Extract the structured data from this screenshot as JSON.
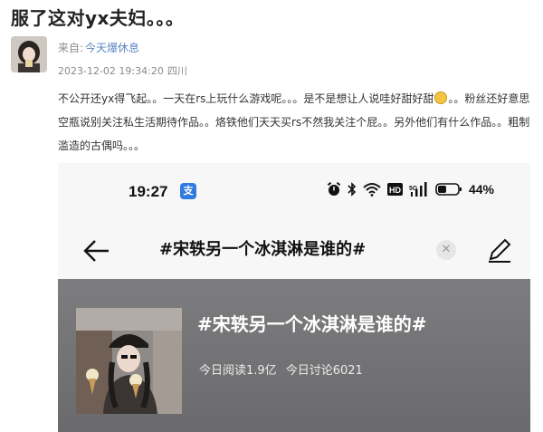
{
  "post": {
    "title": "服了这对yx夫妇。。。",
    "from_label": "来自:",
    "from_source": "今天爆休息",
    "timestamp": "2023-12-02 19:34:20",
    "location": "四川",
    "body_part1": "不公开还yx得飞起。。一天在rs上玩什么游戏呢。。。是不是想让人说哇好甜好甜",
    "body_part2": "。。粉丝还好意思空瓶说别关注私生活期待作品。。烙铁他们天天买rs不然我关注个屁。。另外他们有什么作品。。粗制滥造的古偶吗。。。",
    "emoji_icon": "emoji-face-icon"
  },
  "screenshot": {
    "status_bar": {
      "time": "19:27",
      "app_icon_glyph": "支",
      "battery": "44%"
    },
    "search": {
      "query": "#宋轶另一个冰淇淋是谁的#",
      "clear_glyph": "✕"
    },
    "topic": {
      "name": "#宋轶另一个冰淇淋是谁的#",
      "reads": "今日阅读1.9亿",
      "discussions": "今日讨论6021"
    },
    "colors": {
      "card_bg": "#737375",
      "app_icon": "#2f7be0"
    }
  }
}
